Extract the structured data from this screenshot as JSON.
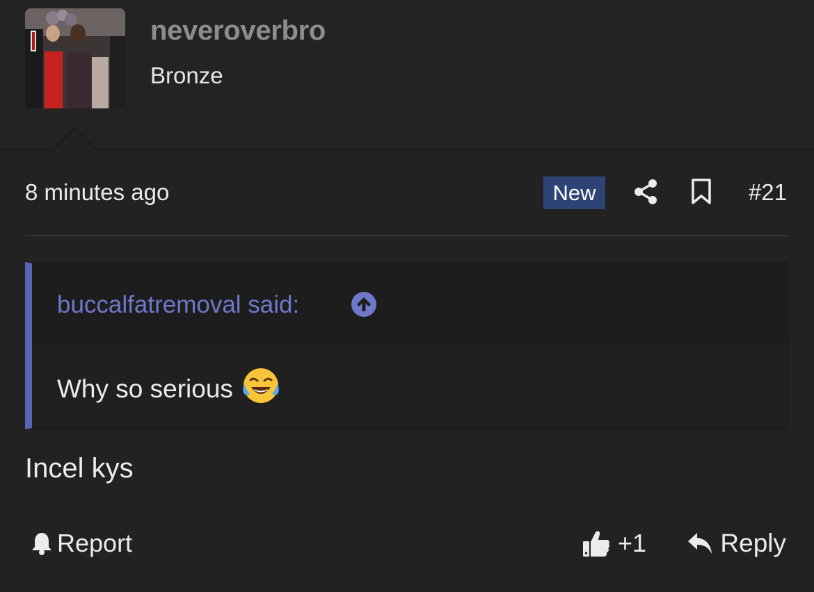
{
  "user": {
    "username": "neveroverbro",
    "title": "Bronze"
  },
  "post": {
    "timestamp": "8 minutes ago",
    "badge": "New",
    "number": "#21",
    "body": "Incel kys"
  },
  "quote": {
    "author_line": "buccalfatremoval said:",
    "text": "Why so serious",
    "emoji": "face-with-tears-of-joy"
  },
  "actions": {
    "report_label": "Report",
    "reaction_count": "+1",
    "reply_label": "Reply"
  },
  "colors": {
    "background": "#222222",
    "accent": "#5b64b6",
    "badge": "#2f4476",
    "username": "#8d8d8d"
  },
  "icons": [
    "share-icon",
    "bookmark-icon",
    "arrow-up-circle-icon",
    "bell-icon",
    "thumbs-up-icon",
    "reply-arrow-icon"
  ]
}
